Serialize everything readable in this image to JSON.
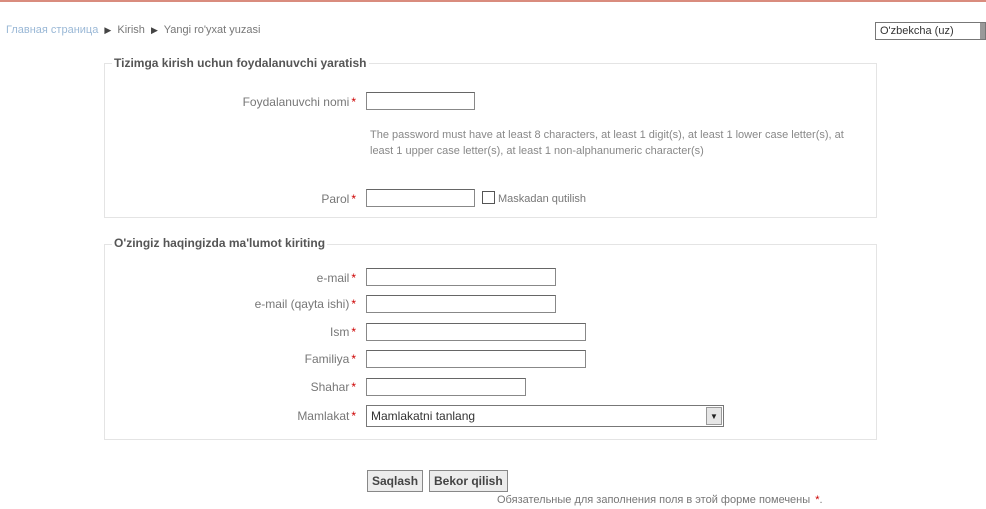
{
  "breadcrumb": {
    "home": "Главная страница",
    "login": "Kirish",
    "current": "Yangi ro'yxat yuzasi"
  },
  "language": {
    "selected": "O'zbekcha (uz)"
  },
  "section1": {
    "legend": "Tizimga kirish uchun foydalanuvchi yaratish",
    "username_label": "Foydalanuvchi nomi",
    "username_value": "",
    "password_hint": "The password must have at least 8 characters, at least 1 digit(s), at least 1 lower case letter(s), at least 1 upper case letter(s), at least 1 non-alphanumeric character(s)",
    "password_label": "Parol",
    "password_value": "",
    "unmask_label": "Maskadan qutilish"
  },
  "section2": {
    "legend": "O'zingiz haqingizda ma'lumot kiriting",
    "email_label": "e-mail",
    "email_value": "",
    "email2_label": "e-mail (qayta ishi)",
    "email2_value": "",
    "firstname_label": "Ism",
    "firstname_value": "",
    "lastname_label": "Familiya",
    "lastname_value": "",
    "city_label": "Shahar",
    "city_value": "",
    "country_label": "Mamlakat",
    "country_selected": "Mamlakatni tanlang"
  },
  "required_mark": "*",
  "buttons": {
    "save": "Saqlash",
    "cancel": "Bekor qilish"
  },
  "footnote": "Обязательные для заполнения поля в этой форме помечены"
}
